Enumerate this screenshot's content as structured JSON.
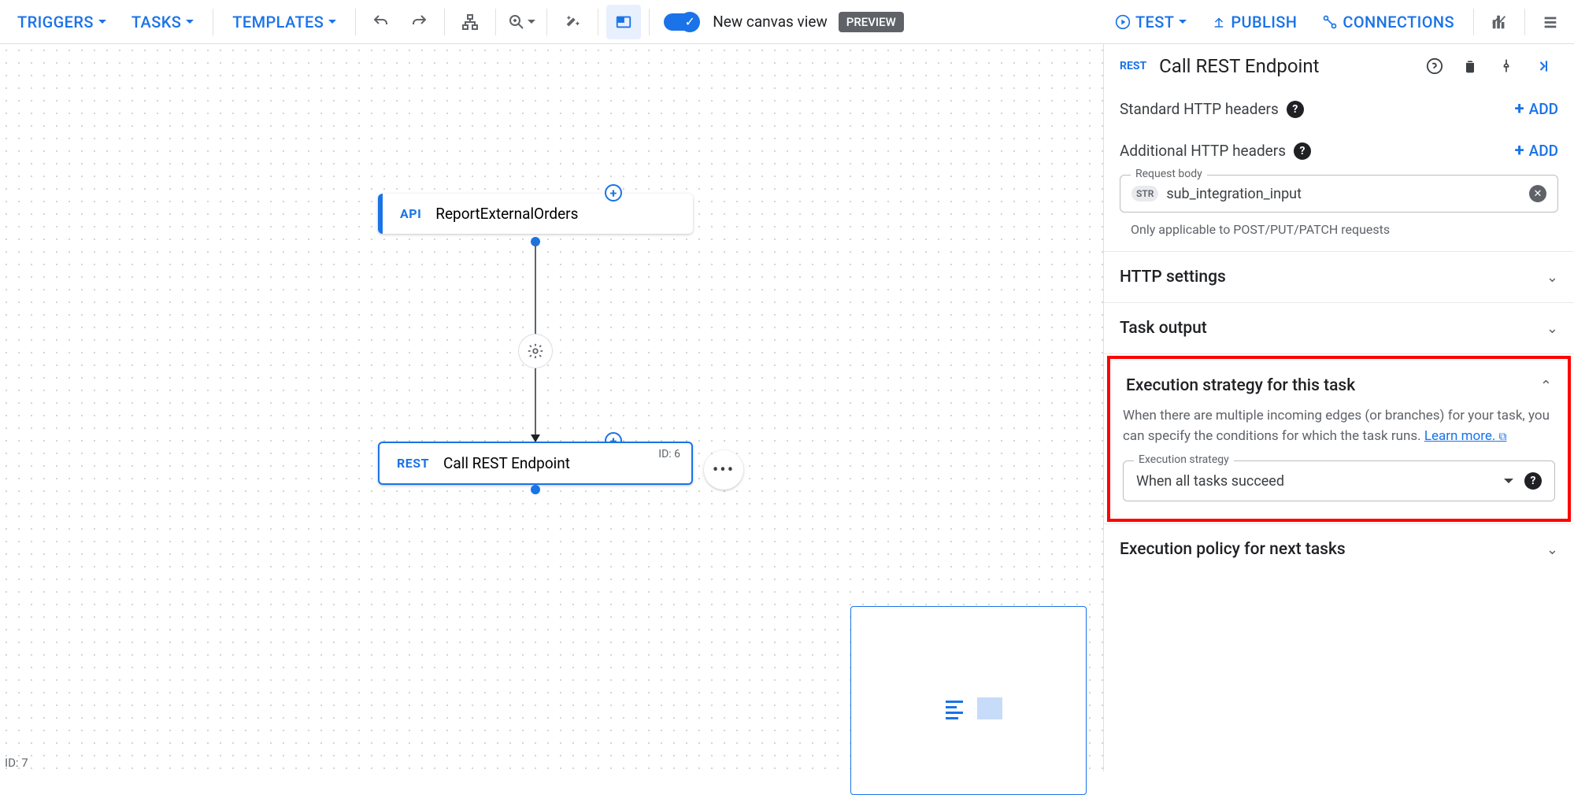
{
  "toolbar": {
    "triggers": "TRIGGERS",
    "tasks": "TASKS",
    "templates": "TEMPLATES",
    "canvas_toggle_label": "New canvas view",
    "preview_badge": "PREVIEW",
    "test": "TEST",
    "publish": "PUBLISH",
    "connections": "CONNECTIONS"
  },
  "canvas": {
    "node1": {
      "tag": "API",
      "label": "ReportExternalOrders"
    },
    "node2": {
      "tag": "REST",
      "label": "Call REST Endpoint",
      "id": "ID: 6"
    },
    "footer_id": "ID: 7"
  },
  "panel": {
    "tag": "REST",
    "title": "Call REST Endpoint",
    "std_headers_label": "Standard HTTP headers",
    "add_label": "ADD",
    "addl_headers_label": "Additional HTTP headers",
    "request_body": {
      "legend": "Request body",
      "chip": "STR",
      "value": "sub_integration_input",
      "hint": "Only applicable to POST/PUT/PATCH requests"
    },
    "sections": {
      "http_settings": "HTTP settings",
      "task_output": "Task output",
      "exec_strategy": {
        "title": "Execution strategy for this task",
        "desc1": "When there are multiple incoming edges (or branches) for your task, you can specify the conditions for which the task runs. ",
        "learn_more": "Learn more.",
        "select_legend": "Execution strategy",
        "select_value": "When all tasks succeed"
      },
      "exec_policy": "Execution policy for next tasks"
    }
  }
}
